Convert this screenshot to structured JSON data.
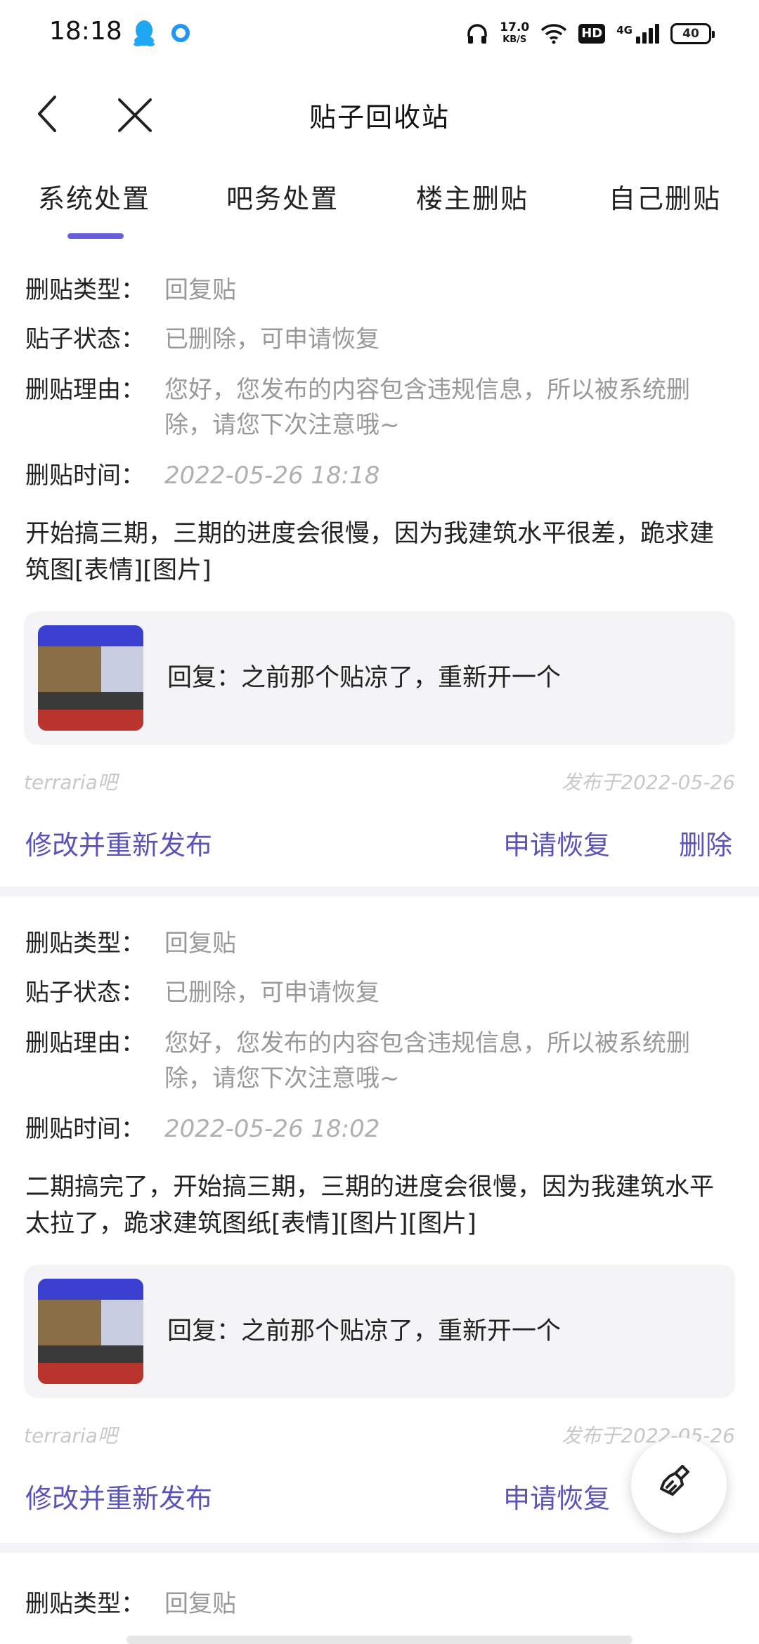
{
  "status_bar": {
    "time": "18:18",
    "net_speed_value": "17.0",
    "net_speed_unit": "KB/S",
    "hd": "HD",
    "network": "4G",
    "battery": "40"
  },
  "header": {
    "title": "贴子回收站",
    "back_icon": "chevron-left-icon",
    "close_icon": "close-icon"
  },
  "tabs": [
    {
      "label": "系统处置",
      "active": true
    },
    {
      "label": "吧务处置",
      "active": false
    },
    {
      "label": "楼主删贴",
      "active": false
    },
    {
      "label": "自己删贴",
      "active": false
    }
  ],
  "labels": {
    "type": "删贴类型：",
    "state": "贴子状态：",
    "reason": "删贴理由：",
    "time": "删贴时间："
  },
  "posts": [
    {
      "type": "回复贴",
      "state": "已删除，可申请恢复",
      "reason": "您好，您发布的内容包含违规信息，所以被系统删除，请您下次注意哦~",
      "time": "2022-05-26 18:18",
      "content": "开始搞三期，三期的进度会很慢，因为我建筑水平很差，跪求建筑图[表情][图片]",
      "quote": "回复：之前那个贴凉了，重新开一个",
      "forum": "terraria吧",
      "posted": "发布于2022-05-26",
      "actions": {
        "edit": "修改并重新发布",
        "restore": "申请恢复",
        "delete": "删除"
      }
    },
    {
      "type": "回复贴",
      "state": "已删除，可申请恢复",
      "reason": "您好，您发布的内容包含违规信息，所以被系统删除，请您下次注意哦~",
      "time": "2022-05-26 18:02",
      "content": "二期搞完了，开始搞三期，三期的进度会很慢，因为我建筑水平太拉了，跪求建筑图纸[表情][图片][图片]",
      "quote": "回复：之前那个贴凉了，重新开一个",
      "forum": "terraria吧",
      "posted": "发布于2022-05-26",
      "actions": {
        "edit": "修改并重新发布",
        "restore": "申请恢复"
      }
    },
    {
      "type": "回复贴"
    }
  ],
  "fab": {
    "icon": "broom-icon"
  }
}
